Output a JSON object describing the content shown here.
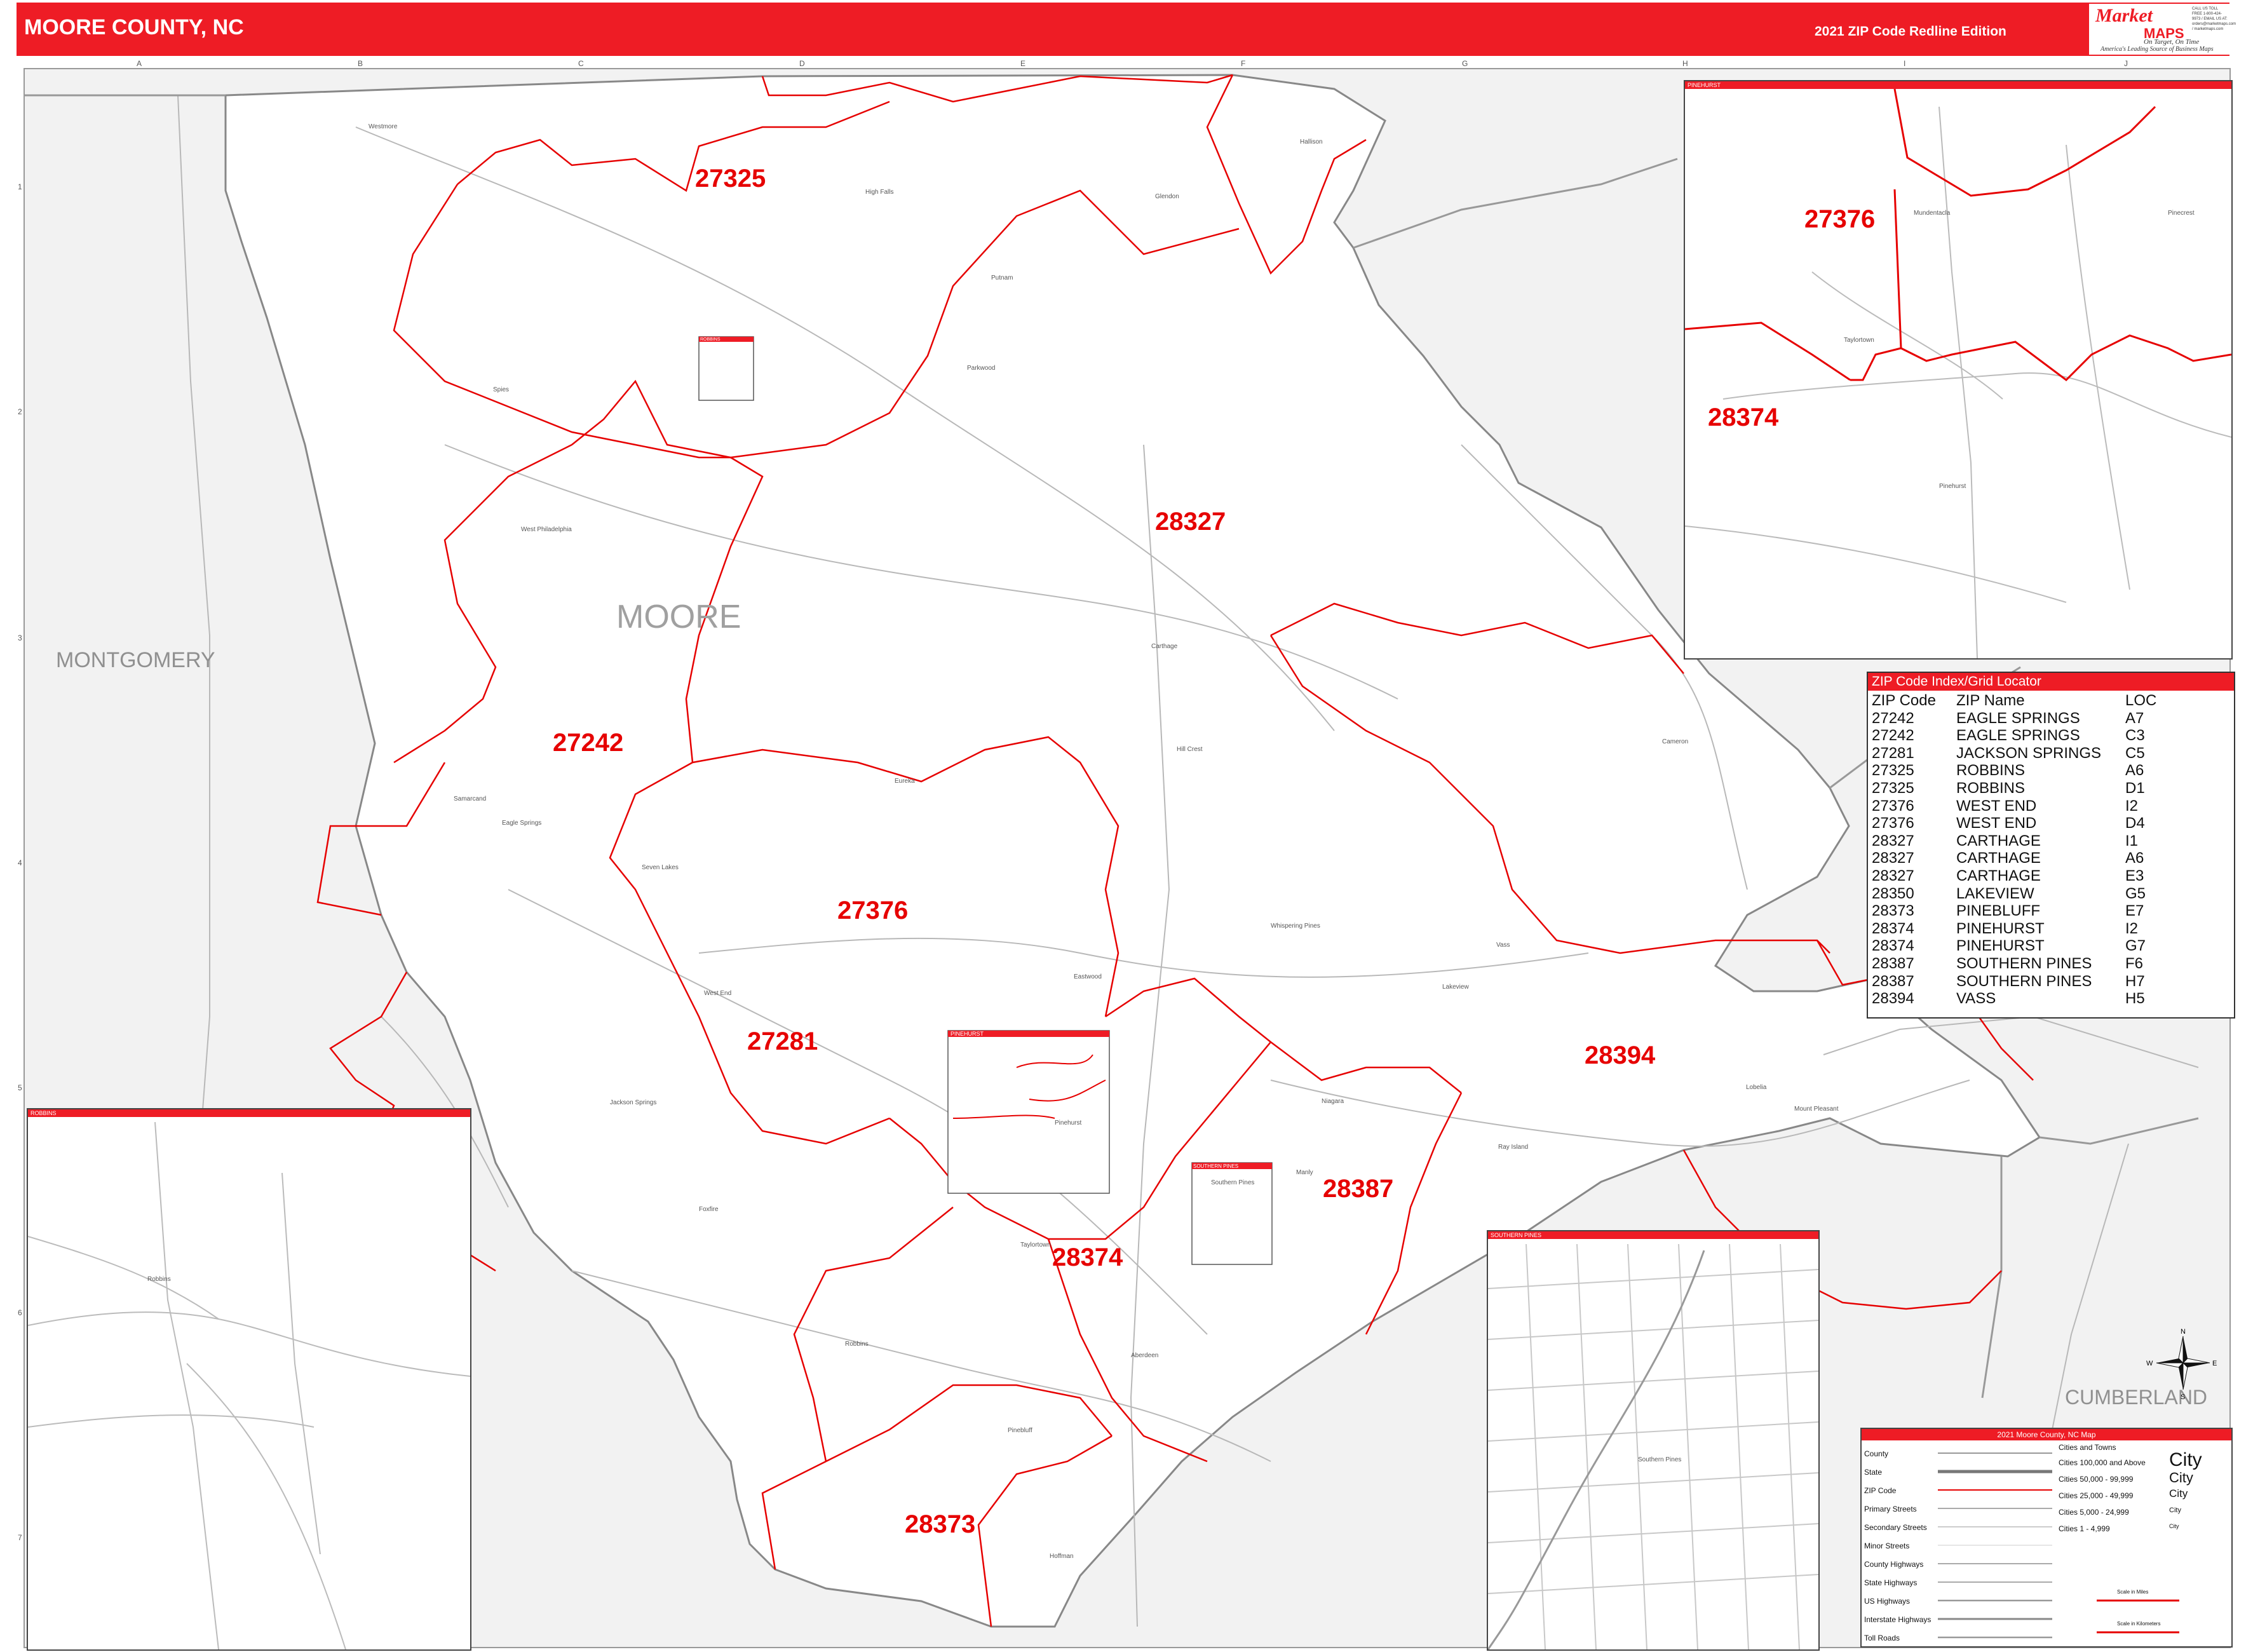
{
  "header": {
    "title": "MOORE COUNTY, NC",
    "edition": "2021 ZIP Code Redline Edition",
    "logo_market": "Market",
    "logo_maps": "MAPS",
    "logo_tag1": "On Target, On Time",
    "logo_tag2": "America's Leading Source of Business Maps",
    "logo_contact": "CALL US TOLL FREE 1-800-424-9973 / EMAIL US AT: orders@marketmaps.com / marketmaps.com"
  },
  "grid": {
    "columns": [
      "A",
      "B",
      "C",
      "D",
      "E",
      "F",
      "G",
      "H",
      "I",
      "J"
    ],
    "rows": [
      "1",
      "2",
      "3",
      "4",
      "5",
      "6",
      "7"
    ]
  },
  "county_labels": {
    "main": "MOORE",
    "west": "MONTGOMERY",
    "southeast": "CUMBERLAND"
  },
  "zip_labels": [
    "27325",
    "28327",
    "27242",
    "27376",
    "27281",
    "28374",
    "28394",
    "28387",
    "28373"
  ],
  "place_names": [
    "Westmore",
    "High Falls",
    "Glendon",
    "Hallison",
    "Putnam",
    "Parkwood",
    "Spies",
    "West Philadelphia",
    "Carthage",
    "Hill Crest",
    "Eureka",
    "Samarcand",
    "Eagle Springs",
    "Seven Lakes",
    "West End",
    "Eastwood",
    "Whispering Pines",
    "Cameron",
    "Vass",
    "Jackson Springs",
    "Foxfire",
    "Robbins",
    "Taylortown",
    "Aberdeen",
    "Pinebluff",
    "Southern Pines",
    "Lakeview",
    "Niagara",
    "Hoffman",
    "Pinehurst",
    "Mount Pleasant",
    "Lobelia",
    "Ray Island",
    "Manly"
  ],
  "insets": {
    "pinehurst": {
      "title": "PINEHURST",
      "zip_a": "27376",
      "zip_b": "28374",
      "places": [
        "Mundentacla",
        "Taylortown",
        "Pinehurst",
        "Pinecrest"
      ]
    },
    "robbins": {
      "title": "ROBBINS",
      "places": [
        "Robbins"
      ]
    },
    "southern_pines": {
      "title": "SOUTHERN PINES",
      "places": [
        "Southern Pines"
      ]
    },
    "pinehurst_marker": "PINEHURST",
    "robbins_marker": "ROBBINS",
    "southern_pines_marker": "SOUTHERN PINES"
  },
  "zip_index": {
    "title": "ZIP Code Index/Grid Locator",
    "columns": [
      "ZIP Code",
      "ZIP Name",
      "LOC"
    ],
    "rows": [
      [
        "27242",
        "EAGLE SPRINGS",
        "A7"
      ],
      [
        "27242",
        "EAGLE SPRINGS",
        "C3"
      ],
      [
        "27281",
        "JACKSON SPRINGS",
        "C5"
      ],
      [
        "27325",
        "ROBBINS",
        "A6"
      ],
      [
        "27325",
        "ROBBINS",
        "D1"
      ],
      [
        "27376",
        "WEST END",
        "I2"
      ],
      [
        "27376",
        "WEST END",
        "D4"
      ],
      [
        "28327",
        "CARTHAGE",
        "I1"
      ],
      [
        "28327",
        "CARTHAGE",
        "A6"
      ],
      [
        "28327",
        "CARTHAGE",
        "E3"
      ],
      [
        "28350",
        "LAKEVIEW",
        "G5"
      ],
      [
        "28373",
        "PINEBLUFF",
        "E7"
      ],
      [
        "28374",
        "PINEHURST",
        "I2"
      ],
      [
        "28374",
        "PINEHURST",
        "G7"
      ],
      [
        "28387",
        "SOUTHERN PINES",
        "F6"
      ],
      [
        "28387",
        "SOUTHERN PINES",
        "H7"
      ],
      [
        "28394",
        "VASS",
        "H5"
      ]
    ]
  },
  "legend": {
    "title": "2021 Moore County, NC Map",
    "items": [
      "County",
      "State",
      "ZIP Code",
      "Primary Streets",
      "Secondary Streets",
      "Minor Streets",
      "County Highways",
      "State Highways",
      "US Highways",
      "Interstate Highways",
      "Toll Roads"
    ],
    "cities_header": "Cities and Towns",
    "city_sizes": [
      "Cities 100,000 and Above",
      "Cities 50,000 - 99,999",
      "Cities 25,000 - 49,999",
      "Cities 5,000 - 24,999",
      "Cities 1 - 4,999"
    ],
    "city_samples": [
      "City",
      "City",
      "City",
      "City",
      "City"
    ],
    "scale_miles": "Scale in Miles",
    "scale_km": "Scale in Kilometers"
  },
  "compass": {
    "n": "N",
    "s": "S",
    "e": "E",
    "w": "W"
  },
  "colors": {
    "brand_red": "#ee1c25",
    "background_gray": "#f2f2f2",
    "road_gray": "#b8b8b8"
  }
}
